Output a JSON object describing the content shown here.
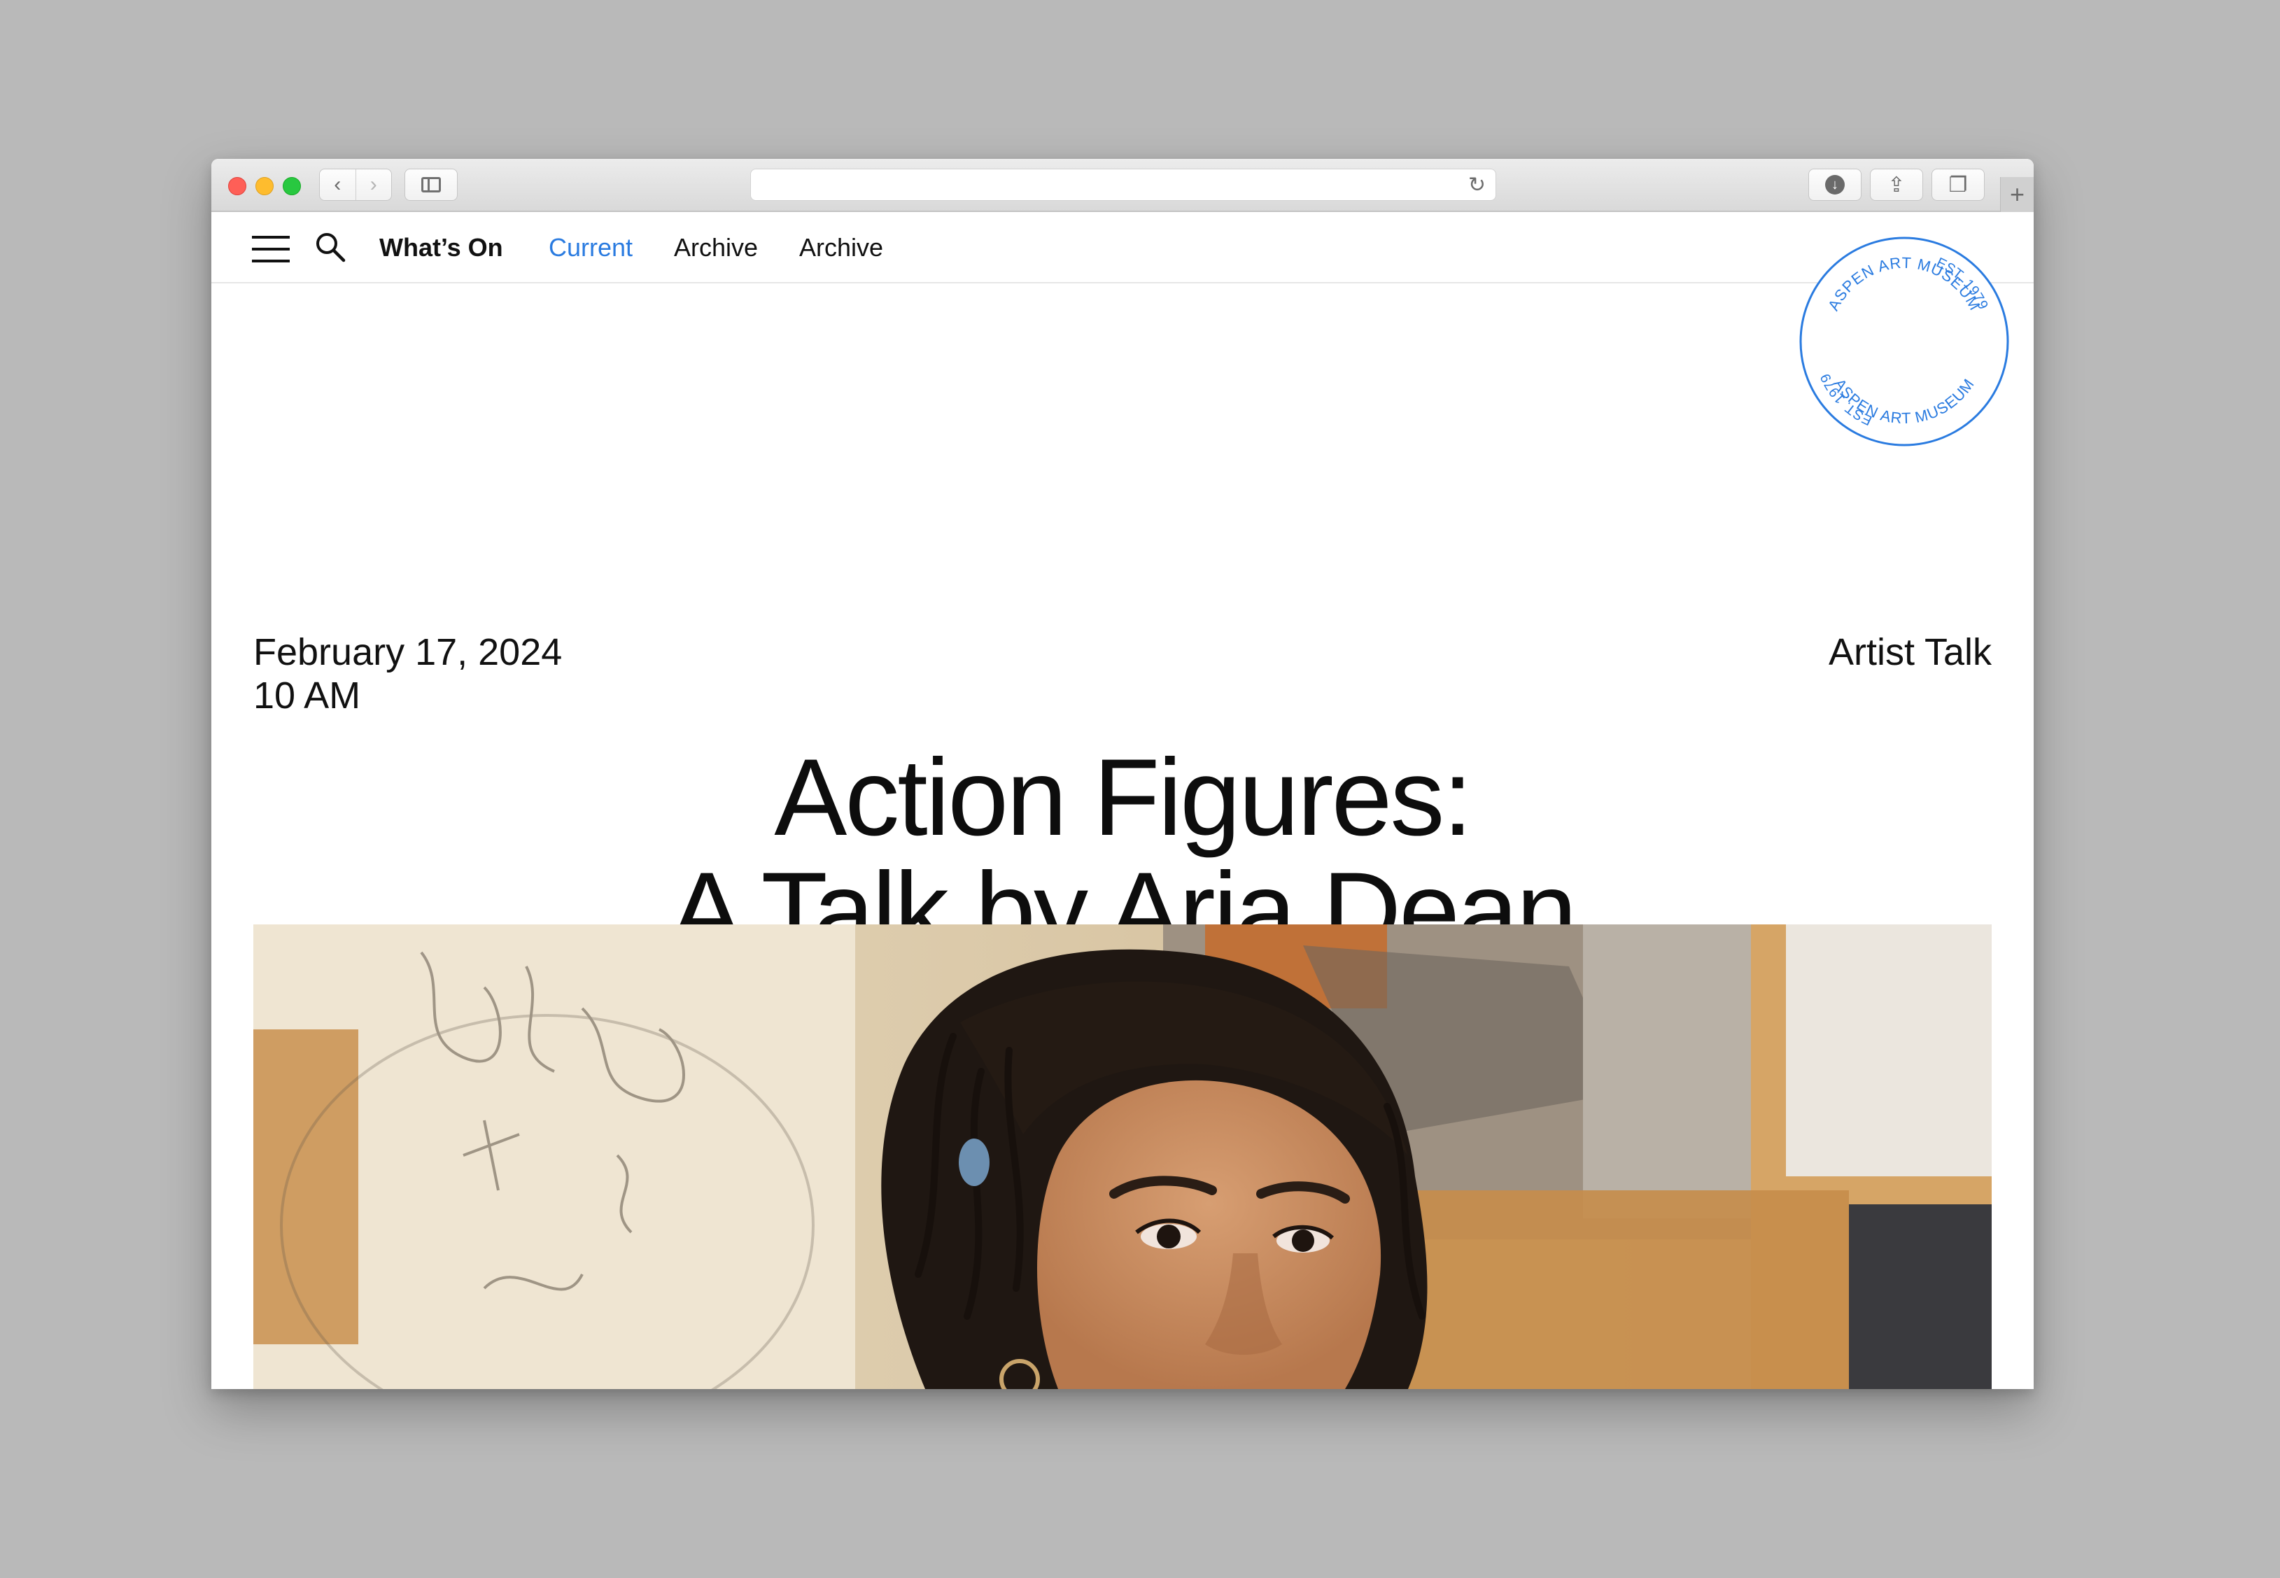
{
  "browser": {
    "back_glyph": "‹",
    "forward_glyph": "›",
    "reload_glyph": "↻",
    "download_glyph": "↓",
    "share_glyph": "⇪",
    "tabs_glyph": "❐",
    "new_tab_glyph": "+"
  },
  "nav": {
    "whats_on": "What’s On",
    "current": "Current",
    "archive_1": "Archive",
    "archive_2": "Archive",
    "accent_color": "#2a7be0"
  },
  "seal": {
    "top_text": "ASPEN ART MUSEUM",
    "bottom_text": "ASPEN ART MUSEUM",
    "left_text": "EST. 1979",
    "right_text": "EST. 1979",
    "color": "#2a7be0"
  },
  "event": {
    "date": "February 17, 2024",
    "time": "10 AM",
    "category": "Artist Talk",
    "title_line1": "Action Figures:",
    "title_line2": "A Talk by Aria Dean"
  }
}
